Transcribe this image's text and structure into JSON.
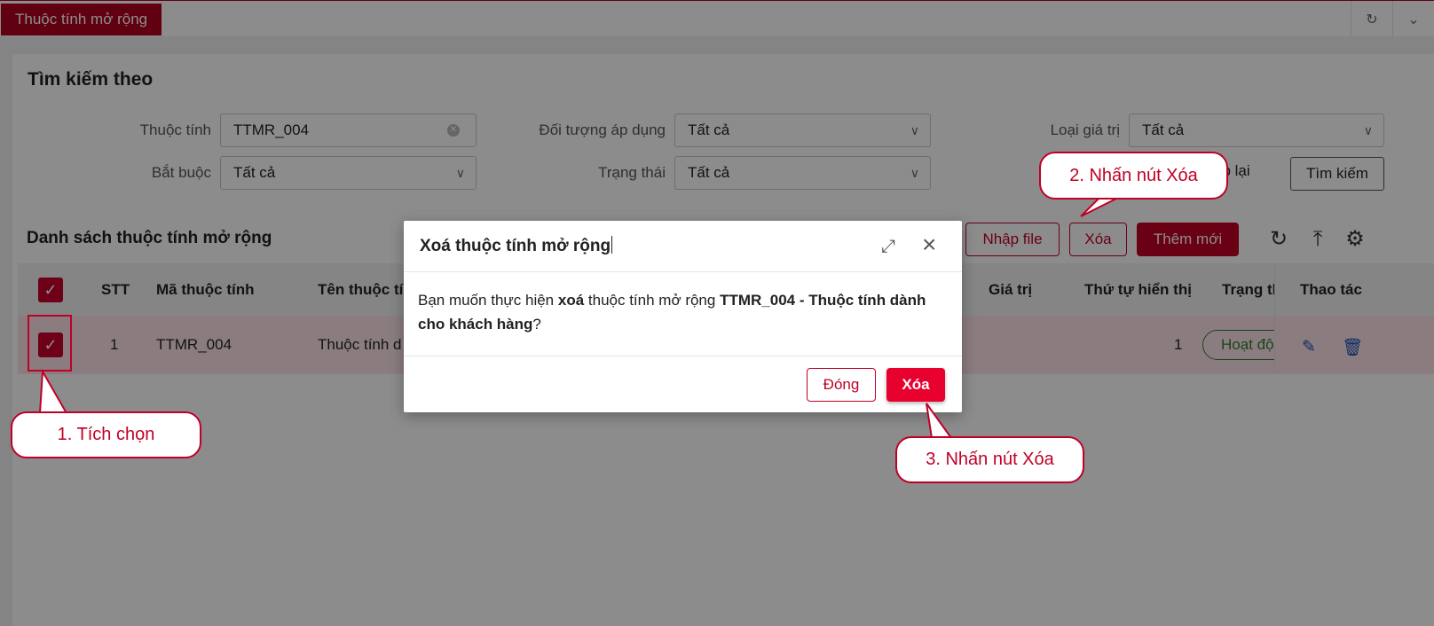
{
  "topbar": {
    "tab_label": "Thuộc tính mở rộng",
    "icons": [
      "refresh-icon",
      "chevron-down-icon"
    ]
  },
  "search": {
    "title": "Tìm kiếm theo",
    "attribute_label": "Thuộc tính",
    "attribute_value": "TTMR_004",
    "target_label": "Đối tượng áp dụng",
    "target_value": "Tất cả",
    "value_type_label": "Loại giá trị",
    "value_type_value": "Tất cả",
    "required_label": "Bắt buộc",
    "required_value": "Tất cả",
    "status_label": "Trạng thái",
    "status_value": "Tất cả",
    "reset_label": "ập lại",
    "search_button": "Tìm kiếm"
  },
  "list": {
    "title": "Danh sách thuộc tính mở rộng",
    "import_button": "Nhập file",
    "delete_button": "Xóa",
    "add_button": "Thêm mới",
    "toolbar_icons": [
      "reload-icon",
      "column-height-icon",
      "settings-icon"
    ],
    "columns": {
      "stt": "STT",
      "code": "Mã thuộc tính",
      "name": "Tên thuộc tín",
      "value": "Giá trị",
      "order": "Thứ tự hiển thị",
      "status": "Trạng th",
      "actions": "Thao tác"
    },
    "rows": [
      {
        "stt": "1",
        "code": "TTMR_004",
        "name": "Thuộc tính d",
        "order": "1",
        "status": "Hoạt độ",
        "selected": true
      }
    ]
  },
  "modal": {
    "title": "Xoá thuộc tính mở rộng",
    "body_prefix": "Bạn muốn thực hiện ",
    "body_bold_action": "xoá",
    "body_middle": " thuộc tính mở rộng ",
    "body_bold_target": "TTMR_004 - Thuộc tính dành cho khách hàng",
    "body_suffix": "?",
    "close_button": "Đóng",
    "delete_button": "Xóa"
  },
  "callouts": {
    "step1": "1. Tích chọn",
    "step2": "2. Nhấn nút Xóa",
    "step3": "3. Nhấn nút Xóa"
  },
  "colors": {
    "brand": "#c00026",
    "selected_row": "#fde4e7",
    "status_green": "#2e7d32",
    "action_blue": "#1a4fb5"
  }
}
